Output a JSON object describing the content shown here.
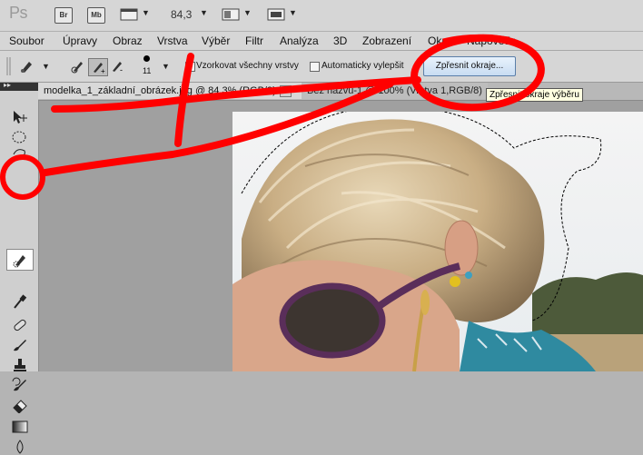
{
  "app": {
    "logo": "Ps",
    "launch_buttons": [
      "Br",
      "Mb"
    ],
    "zoom": "84,3"
  },
  "menu": [
    "Soubor",
    "Úpravy",
    "Obraz",
    "Vrstva",
    "Výběr",
    "Filtr",
    "Analýza",
    "3D",
    "Zobrazení",
    "Okno",
    "Nápověda"
  ],
  "options": {
    "brush_size": "11",
    "sample_all_layers_label": "Vzorkovat všechny vrstvy",
    "auto_enhance_label": "Automaticky vylepšit",
    "refine_edge_label": "Zpřesnit okraje...",
    "tooltip": "Zpřesnit okraje výběru"
  },
  "tabs": [
    {
      "label": "modelka_1_základní_obrázek.jpg @ 84,3% (RGB/8)",
      "close": "×"
    },
    {
      "label": "Bez názvu-1 @ 100% (Vrstva 1,RGB/8)"
    }
  ],
  "colors": {
    "annotation": "#ff0000",
    "refine_button": "#c8dcf2"
  },
  "tools": [
    "move-tool",
    "marquee-tool",
    "lasso-tool",
    "quick-selection-tool",
    "eyedropper-tool",
    "healing-brush-tool",
    "brush-tool",
    "clone-stamp-tool",
    "history-brush-tool",
    "eraser-tool",
    "gradient-tool",
    "blur-tool"
  ]
}
